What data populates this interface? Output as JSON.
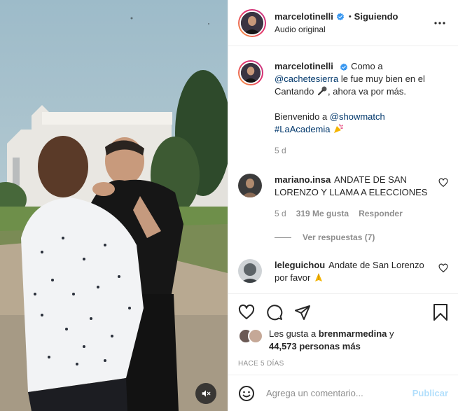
{
  "header": {
    "username": "marcelotinelli",
    "separator": "•",
    "follow_status": "Siguiendo",
    "audio": "Audio original"
  },
  "caption": {
    "username": "marcelotinelli",
    "text_1": "Como a",
    "mention_1": "@cachetesierra",
    "text_2": "le fue muy bien en el Cantando",
    "text_3": ", ahora va por más.",
    "text_4": "Bienvenido a",
    "mention_2": "@showmatch",
    "hashtag": "#LaAcademia",
    "time": "5 d"
  },
  "comments": [
    {
      "username": "mariano.insa",
      "text": "ANDATE DE SAN LORENZO Y LLAMA A ELECCIONES",
      "time": "5 d",
      "likes": "319 Me gusta",
      "reply": "Responder",
      "view_replies": "Ver respuestas (7)"
    },
    {
      "username": "leleguichou",
      "text": "Andate de San Lorenzo por favor"
    }
  ],
  "likes": {
    "prefix": "Les gusta a",
    "user": "brenmarmedina",
    "joiner": "y",
    "count": "44,573 personas más"
  },
  "timestamp": "Hace 5 días",
  "add_comment": {
    "placeholder": "Agrega un comentario...",
    "publish": "Publicar"
  },
  "colors": {
    "verified": "#3897f0",
    "link": "#00376b",
    "muted": "#8e8e8e",
    "publish_disabled": "#b2dffc"
  },
  "icons": {
    "verified": "verified-badge-icon",
    "more": "more-options-icon",
    "like": "heart-icon",
    "comment": "comment-icon",
    "share": "paper-plane-icon",
    "save": "bookmark-icon",
    "mute": "muted-speaker-icon",
    "emoji": "smiley-icon",
    "microphone": "microphone-emoji-icon",
    "party": "party-popper-emoji-icon",
    "pray": "folded-hands-emoji-icon"
  }
}
